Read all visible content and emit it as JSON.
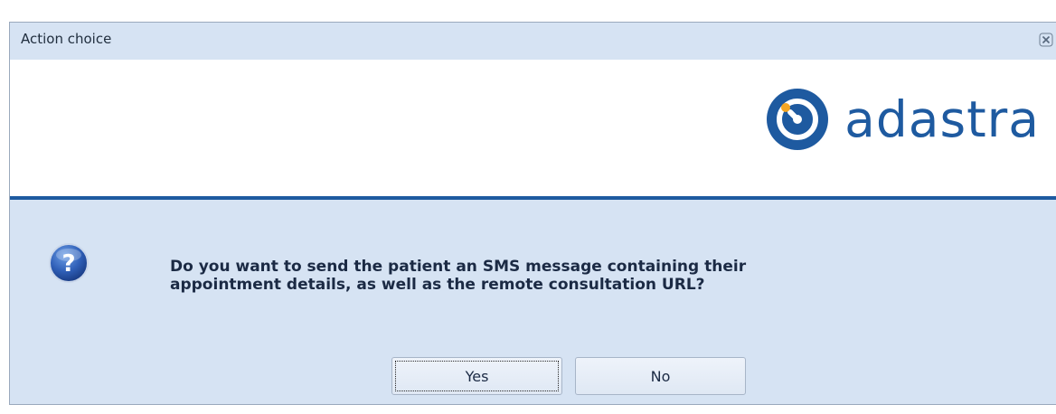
{
  "window": {
    "title": "Action choice",
    "close_icon": "close-icon"
  },
  "banner": {
    "logo_text": "adastra",
    "logo_icon": "adastra-logo-icon",
    "brand_color": "#1e5aa0"
  },
  "dialog": {
    "icon": "question-icon",
    "message_line1": "Do you want to send the patient an SMS message containing their",
    "message_line2": "appointment details, as well as the remote consultation URL?"
  },
  "buttons": {
    "yes_label": "Yes",
    "no_label": "No"
  }
}
